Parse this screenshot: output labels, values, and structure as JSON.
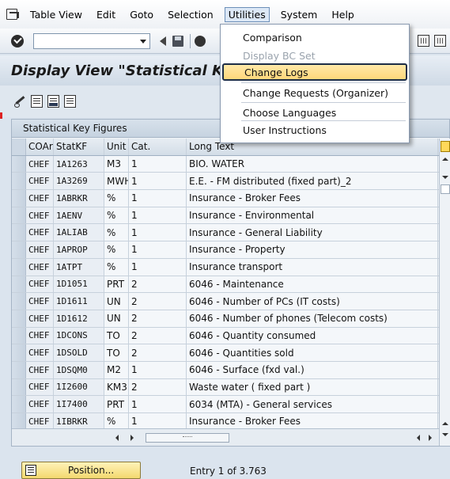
{
  "menubar": {
    "items": [
      "Table View",
      "Edit",
      "Goto",
      "Selection",
      "Utilities",
      "System",
      "Help"
    ],
    "active_index": 4
  },
  "toolbar": {
    "command_value": ""
  },
  "title": "Display View \"Statistical Key",
  "table": {
    "caption": "Statistical Key Figures",
    "columns": [
      "COAr",
      "StatKF",
      "Unit",
      "Cat.",
      "Long Text"
    ],
    "rows": [
      [
        "CHEF",
        "1A1263",
        "M3",
        "1",
        "BIO. WATER"
      ],
      [
        "CHEF",
        "1A3269",
        "MWH",
        "1",
        "E.E. - FM distributed  (fixed part)_2"
      ],
      [
        "CHEF",
        "1ABRKR",
        "%",
        "1",
        "Insurance - Broker Fees"
      ],
      [
        "CHEF",
        "1AENV",
        "%",
        "1",
        "Insurance - Environmental"
      ],
      [
        "CHEF",
        "1ALIAB",
        "%",
        "1",
        "Insurance - General Liability"
      ],
      [
        "CHEF",
        "1APROP",
        "%",
        "1",
        "Insurance - Property"
      ],
      [
        "CHEF",
        "1ATPT",
        "%",
        "1",
        "Insurance transport"
      ],
      [
        "CHEF",
        "1D1051",
        "PRT",
        "2",
        "6046 - Maintenance"
      ],
      [
        "CHEF",
        "1D1611",
        "UN",
        "2",
        "6046 - Number of PCs (IT costs)"
      ],
      [
        "CHEF",
        "1D1612",
        "UN",
        "2",
        "6046 - Number of phones (Telecom costs)"
      ],
      [
        "CHEF",
        "1DCONS",
        "TO",
        "2",
        "6046 - Quantity consumed"
      ],
      [
        "CHEF",
        "1DSOLD",
        "TO",
        "2",
        "6046 - Quantities sold"
      ],
      [
        "CHEF",
        "1DSQM0",
        "M2",
        "1",
        "6046 - Surface (fxd val.)"
      ],
      [
        "CHEF",
        "1I2600",
        "KM3",
        "2",
        "Waste water ( fixed part )"
      ],
      [
        "CHEF",
        "1I7400",
        "PRT",
        "1",
        "6034 (MTA) - General services"
      ],
      [
        "CHEF",
        "1IBRKR",
        "%",
        "1",
        "Insurance - Broker Fees"
      ]
    ]
  },
  "footer": {
    "position_label": "Position...",
    "entry_info": "Entry 1 of 3.763"
  },
  "dropdown": {
    "items": [
      {
        "label": "Comparison",
        "state": "enabled"
      },
      {
        "label": "Display BC Set",
        "state": "disabled"
      },
      {
        "label": "Change Logs",
        "state": "highlighted"
      },
      {
        "label": "Change Requests (Organizer)",
        "state": "enabled"
      },
      {
        "label": "Choose Languages",
        "state": "enabled"
      },
      {
        "label": "User Instructions",
        "state": "enabled"
      }
    ]
  },
  "colors": {
    "highlight": "#ffd77a",
    "highlight_border": "#1d2d46",
    "position_button": "#f3d96f",
    "background": "#dbe4ee"
  },
  "icons": [
    "app-menu-icon",
    "enter-check-icon",
    "back-icon",
    "save-icon",
    "exit-icon",
    "pencil-glasses-icon",
    "select-all-icon",
    "deselect-icon",
    "table-doc-icon",
    "column-settings-icon",
    "position-icon"
  ]
}
